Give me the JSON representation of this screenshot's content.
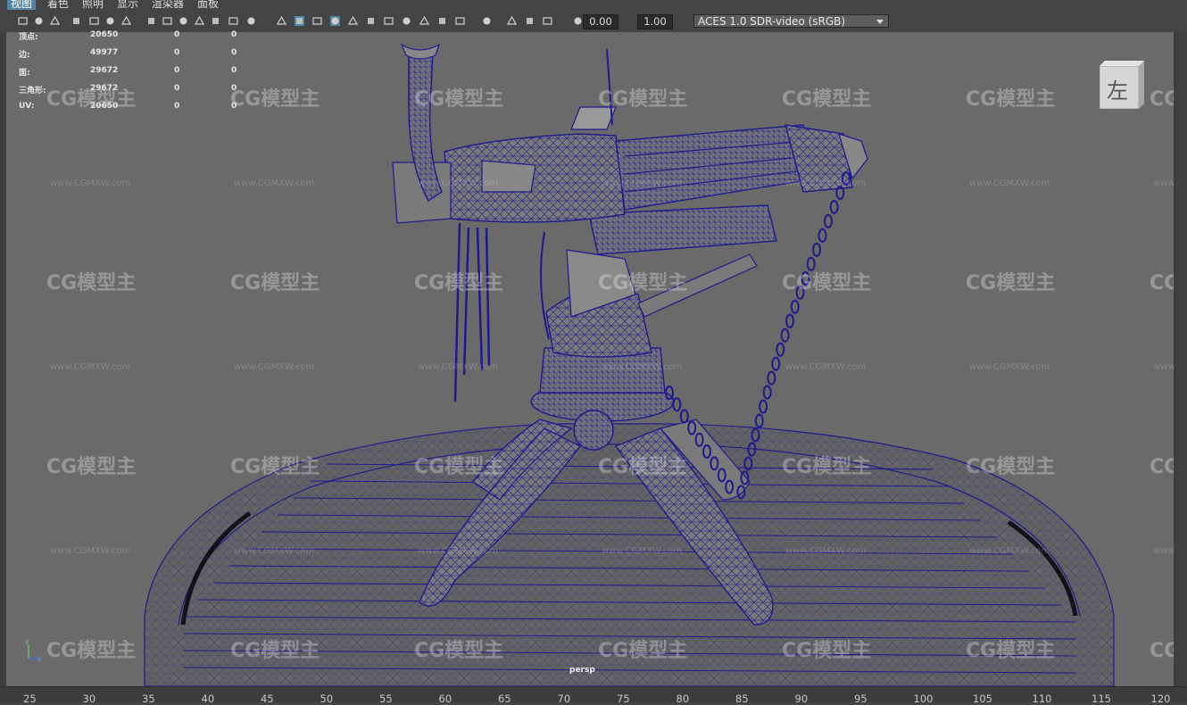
{
  "menubar": {
    "items": [
      "视图",
      "着色",
      "照明",
      "显示",
      "渲染器",
      "面板"
    ],
    "active_index": 0
  },
  "toolbar": {
    "exposure_value": "0.00",
    "gamma_value": "1.00",
    "color_space": "ACES 1.0 SDR-video (sRGB)",
    "icons": [
      "camera-icon",
      "camera-attributes-icon",
      "bookmark-icon",
      "image-plane-icon",
      "two-d-pan-zoom-icon",
      "grease-pencil-icon",
      "grid-icon",
      "film-gate-icon",
      "resolution-gate-icon",
      "gate-mask-icon",
      "field-chart-icon",
      "safe-action-icon",
      "safe-title-icon",
      "wireframe-icon",
      "smooth-shade-icon",
      "default-material-icon",
      "wireframe-on-shaded-icon",
      "textured-icon",
      "use-all-lights-icon",
      "shadows-icon",
      "ambient-occlusion-icon",
      "motion-blur-icon",
      "anti-aliasing-icon",
      "isolate-select-icon",
      "xray-icon",
      "xray-active-components-icon",
      "xray-joints-icon",
      "exposure-icon",
      "gamma-icon",
      "color-management-icon"
    ],
    "accent_color": "#5285a6"
  },
  "hud": {
    "rows": [
      {
        "label": "顶点:",
        "v1": "20650",
        "v2": "0",
        "v3": "0"
      },
      {
        "label": "边:",
        "v1": "49977",
        "v2": "0",
        "v3": "0"
      },
      {
        "label": "面:",
        "v1": "29672",
        "v2": "0",
        "v3": "0"
      },
      {
        "label": "三角形:",
        "v1": "29672",
        "v2": "0",
        "v3": "0"
      },
      {
        "label": "UV:",
        "v1": "20650",
        "v2": "0",
        "v3": "0"
      }
    ]
  },
  "viewcube": {
    "face_label": "左"
  },
  "viewport": {
    "camera_label": "persp",
    "axis": {
      "y": "y",
      "z": "z"
    },
    "background_color": "#6a6a6a",
    "wireframe_color": "#1e1a8c"
  },
  "watermark": {
    "logo_text": "CG模型主",
    "url_text": "www.CGMXW.com"
  },
  "timeline": {
    "ticks": [
      "25",
      "30",
      "35",
      "40",
      "45",
      "50",
      "55",
      "60",
      "65",
      "70",
      "75",
      "80",
      "85",
      "90",
      "95",
      "100",
      "105",
      "110",
      "115",
      "120"
    ]
  }
}
